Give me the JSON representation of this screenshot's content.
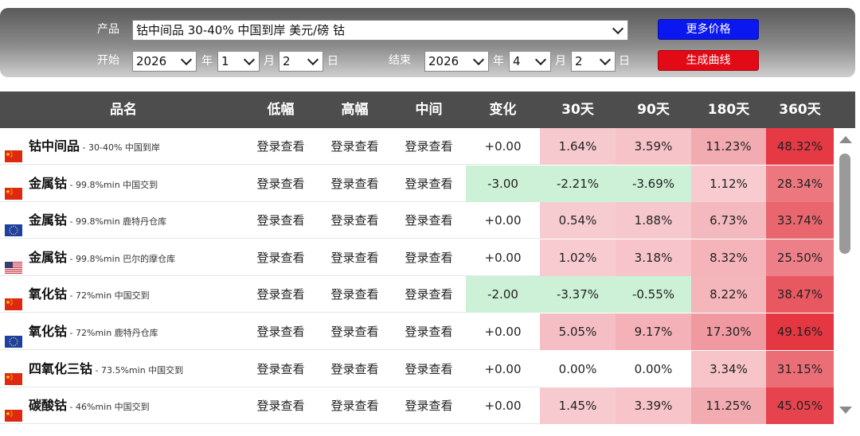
{
  "filters": {
    "product_label": "产品",
    "product_value": "钴中间品 30-40% 中国到岸 美元/磅 钴",
    "start_label": "开始",
    "start_year": "2026",
    "start_year_unit": "年",
    "start_month": "1",
    "start_month_unit": "月",
    "start_day": "2",
    "start_day_unit": "日",
    "end_label": "结束",
    "end_year": "2026",
    "end_year_unit": "年",
    "end_month": "4",
    "end_month_unit": "月",
    "end_day": "2",
    "end_day_unit": "日",
    "more_prices_button": "更多价格",
    "generate_curve_button": "生成曲线"
  },
  "table": {
    "headers": [
      "品名",
      "低幅",
      "高幅",
      "中间",
      "变化",
      "30天",
      "90天",
      "180天",
      "360天"
    ],
    "rows": [
      {
        "flag": "cn-flag",
        "name": "钴中间品",
        "spec": " - 30-40% 中国到岸",
        "low": "登录查看",
        "high": "登录查看",
        "mid": "登录查看",
        "change": "+0.00",
        "d30": "1.64%",
        "d90": "3.59%",
        "d180": "11.23%",
        "d360": "48.32%"
      },
      {
        "flag": "cn-flag",
        "name": "金属钴",
        "spec": " - 99.8%min 中国交到",
        "low": "登录查看",
        "high": "登录查看",
        "mid": "登录查看",
        "change": "-3.00",
        "d30": "-2.21%",
        "d90": "-3.69%",
        "d180": "1.12%",
        "d360": "28.34%"
      },
      {
        "flag": "eu-flag",
        "name": "金属钴",
        "spec": " - 99.8%min 鹿特丹仓库",
        "low": "登录查看",
        "high": "登录查看",
        "mid": "登录查看",
        "change": "+0.00",
        "d30": "0.54%",
        "d90": "1.88%",
        "d180": "6.73%",
        "d360": "33.74%"
      },
      {
        "flag": "us-flag",
        "name": "金属钴",
        "spec": " - 99.8%min 巴尔的摩仓库",
        "low": "登录查看",
        "high": "登录查看",
        "mid": "登录查看",
        "change": "+0.00",
        "d30": "1.02%",
        "d90": "3.18%",
        "d180": "8.32%",
        "d360": "25.50%"
      },
      {
        "flag": "cn-flag",
        "name": "氧化钴",
        "spec": " - 72%min 中国交到",
        "low": "登录查看",
        "high": "登录查看",
        "mid": "登录查看",
        "change": "-2.00",
        "d30": "-3.37%",
        "d90": "-0.55%",
        "d180": "8.22%",
        "d360": "38.47%"
      },
      {
        "flag": "eu-flag",
        "name": "氧化钴",
        "spec": " - 72%min 鹿特丹仓库",
        "low": "登录查看",
        "high": "登录查看",
        "mid": "登录查看",
        "change": "+0.00",
        "d30": "5.05%",
        "d90": "9.17%",
        "d180": "17.30%",
        "d360": "49.16%"
      },
      {
        "flag": "cn-flag",
        "name": "四氧化三钴",
        "spec": " - 73.5%min 中国交到",
        "low": "登录查看",
        "high": "登录查看",
        "mid": "登录查看",
        "change": "+0.00",
        "d30": "0.00%",
        "d90": "0.00%",
        "d180": "3.34%",
        "d360": "31.15%"
      },
      {
        "flag": "cn-flag",
        "name": "碳酸钴",
        "spec": " - 46%min 中国交到",
        "low": "登录查看",
        "high": "登录查看",
        "mid": "登录查看",
        "change": "+0.00",
        "d30": "1.45%",
        "d90": "3.39%",
        "d180": "11.25%",
        "d360": "45.05%"
      }
    ]
  },
  "colors": {
    "header_bg": "#4d4d4d",
    "positive_text": "#222222",
    "negative_bg": "#ccf1d6",
    "scale_light": "#f7ced3",
    "scale_dark": "#e4343f"
  }
}
